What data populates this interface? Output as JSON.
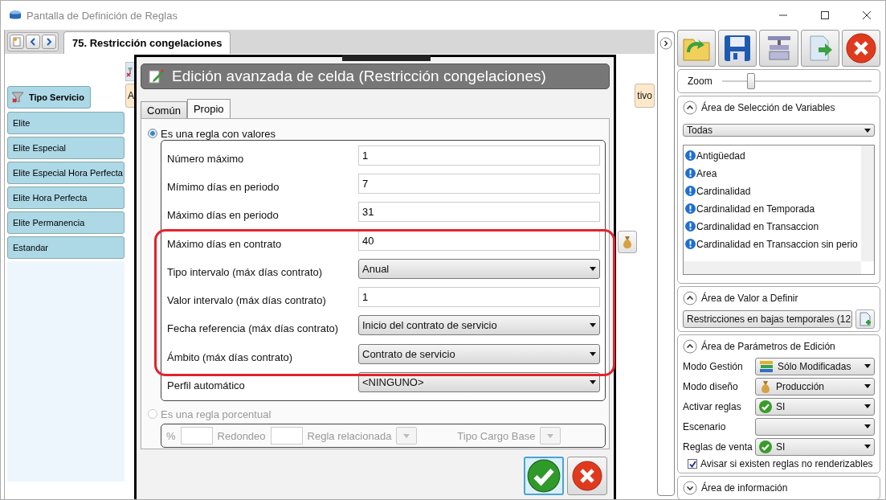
{
  "window": {
    "title": "Pantalla de Definición de Reglas"
  },
  "document_tabs": [
    {
      "label": "75. Restricción congelaciones",
      "selected": true
    }
  ],
  "left_panel": {
    "header": "Tipo Servicio",
    "items": [
      "Elite",
      "Elite Especial",
      "Elite Especial Hora Perfecta",
      "Elite Hora Perfecta",
      "Elite Permanencia",
      "Estandar"
    ]
  },
  "grid_header": {
    "column_1": "A",
    "column_2": "tivo"
  },
  "dialog": {
    "title": "Edición avanzada de celda (Restricción congelaciones)",
    "tabs": [
      {
        "label": "Común",
        "selected": false
      },
      {
        "label": "Propio",
        "selected": true
      }
    ],
    "value_rule": {
      "label": "Es una regla con valores",
      "selected": true,
      "fields": [
        {
          "kind": "text",
          "label": "Número máximo",
          "value": "1",
          "highlighted": false
        },
        {
          "kind": "text",
          "label": "Mímimo días en periodo",
          "value": "7",
          "highlighted": false
        },
        {
          "kind": "text",
          "label": "Máximo días en periodo",
          "value": "31",
          "highlighted": false
        },
        {
          "kind": "text",
          "label": "Máximo días en contrato",
          "value": "40",
          "highlighted": true
        },
        {
          "kind": "select",
          "label": "Tipo intervalo (máx días contrato)",
          "value": "Anual",
          "highlighted": true
        },
        {
          "kind": "text",
          "label": "Valor intervalo (máx días contrato)",
          "value": "1",
          "highlighted": true
        },
        {
          "kind": "select",
          "label": "Fecha referencia (máx días contrato)",
          "value": "Inicio del contrato de servicio",
          "highlighted": true
        },
        {
          "kind": "select",
          "label": "Ámbito (máx días contrato)",
          "value": "Contrato de servicio",
          "highlighted": true
        },
        {
          "kind": "select",
          "label": "Perfil automático",
          "value": "<NINGUNO>",
          "highlighted": false
        }
      ]
    },
    "percent_rule": {
      "label": "Es una regla porcentual",
      "selected": false,
      "disabled": true,
      "fields": [
        {
          "kind": "text",
          "label": "%"
        },
        {
          "kind": "text",
          "label": "Redondeo"
        },
        {
          "kind": "select",
          "label": "Regla relacionada"
        },
        {
          "kind": "select",
          "label": "Tipo Cargo Base"
        }
      ]
    }
  },
  "sidebar": {
    "zoom": {
      "label": "Zoom",
      "level": 0.18
    },
    "variables": {
      "title": "Área de Selección de Variables",
      "expanded": true,
      "filter": "Todas",
      "items": [
        "Antigüedad",
        "Area",
        "Cardinalidad",
        "Cardinalidad en Temporada",
        "Cardinalidad en Transaccion",
        "Cardinalidad en Transaccion sin perio"
      ]
    },
    "value": {
      "title": "Área de Valor a Definir",
      "expanded": true,
      "selected_value": "Restricciones en bajas temporales (12"
    },
    "params": {
      "title": "Área de Parámetros de Edición",
      "expanded": true,
      "rows": [
        {
          "label": "Modo Gestión",
          "value": "Sólo Modificadas",
          "kind": "books"
        },
        {
          "label": "Modo diseño",
          "value": "Producción",
          "kind": "moneybag"
        },
        {
          "label": "Activar reglas",
          "value": "SI",
          "kind": "check"
        },
        {
          "label": "Escenario",
          "kind": "none"
        },
        {
          "label": "Reglas de venta",
          "value": "SI",
          "kind": "check"
        }
      ],
      "warn": {
        "label": "Avisar si existen reglas no renderizables",
        "checked": true
      }
    },
    "info": {
      "title": "Área de información",
      "expanded": false
    }
  }
}
